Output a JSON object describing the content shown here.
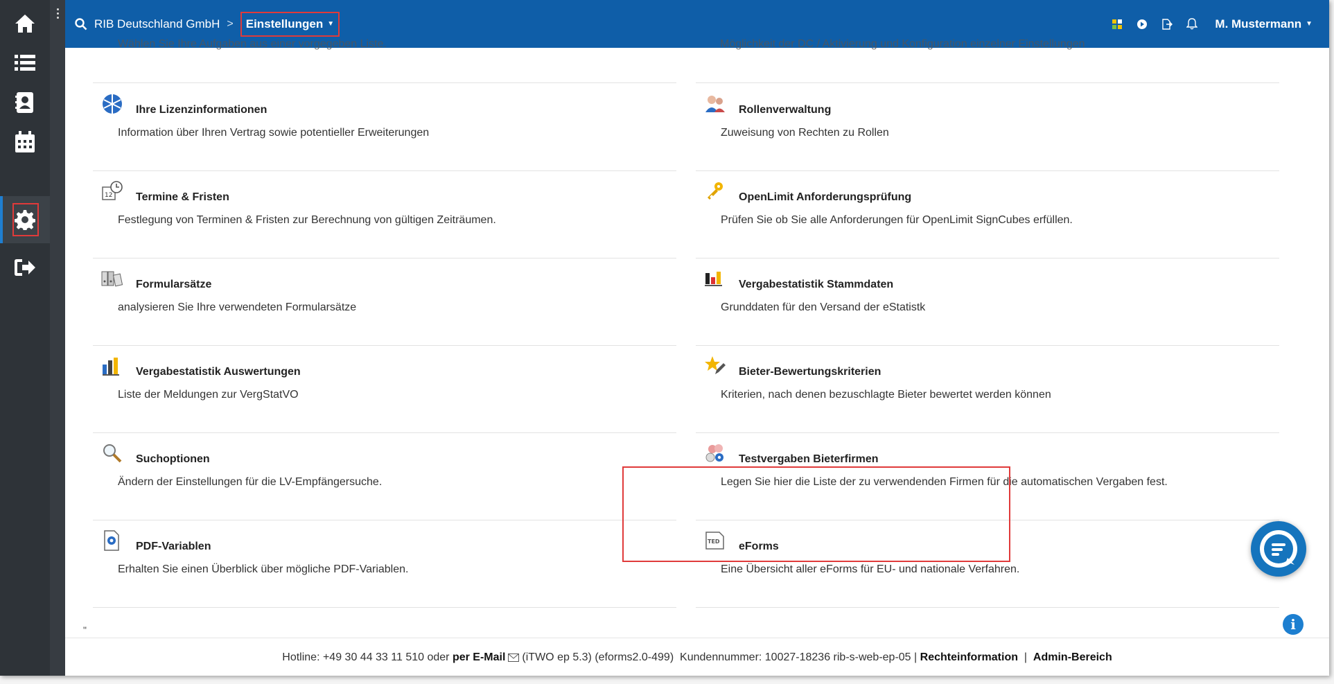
{
  "header": {
    "company": "RIB Deutschland GmbH",
    "separator": ">",
    "breadcrumb": "Einstellungen",
    "user": "M. Mustermann"
  },
  "overflow": {
    "left": "Wählen Sie Ihre Aufgaben aus einer vorgegeben Liste.",
    "right": "Möglichkeit der DC / Aktivierung und Konfiguration einzelner Einstellungen"
  },
  "settings": {
    "left": [
      {
        "title": "Ihre Lizenzinformationen",
        "desc": "Information über Ihren Vertrag sowie potentieller Erweiterungen",
        "icon": "license-icon"
      },
      {
        "title": "Termine & Fristen",
        "desc": "Festlegung von Terminen & Fristen zur Berechnung von gültigen Zeiträumen.",
        "icon": "calendar-clock-icon"
      },
      {
        "title": "Formularsätze",
        "desc": "analysieren Sie Ihre verwendeten Formularsätze",
        "icon": "binders-icon"
      },
      {
        "title": "Vergabestatistik Auswertungen",
        "desc": "Liste der Meldungen zur VergStatVO",
        "icon": "statistics-icon"
      },
      {
        "title": "Suchoptionen",
        "desc": "Ändern der Einstellungen für die LV-Empfängersuche.",
        "icon": "magnifier-icon"
      },
      {
        "title": "PDF-Variablen",
        "desc": "Erhalten Sie einen Überblick über mögliche PDF-Variablen.",
        "icon": "document-gear-icon"
      }
    ],
    "right": [
      {
        "title": "Rollenverwaltung",
        "desc": "Zuweisung von Rechten zu Rollen",
        "icon": "users-roles-icon"
      },
      {
        "title": "OpenLimit Anforderungsprüfung",
        "desc": "Prüfen Sie ob Sie alle Anforderungen für OpenLimit SignCubes erfüllen.",
        "icon": "key-icon"
      },
      {
        "title": "Vergabestatistik Stammdaten",
        "desc": "Grunddaten für den Versand der eStatistk",
        "icon": "bar-chart-icon"
      },
      {
        "title": "Bieter-Bewertungskriterien",
        "desc": "Kriterien, nach denen bezuschlagte Bieter bewertet werden können",
        "icon": "star-pencil-icon"
      },
      {
        "title": "Testvergaben Bieterfirmen",
        "desc": "Legen Sie hier die Liste der zu verwendenden Firmen für die automatischen Vergaben fest.",
        "icon": "company-settings-icon"
      },
      {
        "title": "eForms",
        "desc": "Eine Übersicht aller eForms für EU- und nationale Verfahren.",
        "icon": "ted-icon",
        "ted_label": "TED"
      }
    ]
  },
  "quote_mark": "\"",
  "footer": {
    "hotline": "Hotline: +49 30 44 33 11 510 oder",
    "email_label": "per E-Mail",
    "version": "(iTWO ep 5.3) (eforms2.0-499)",
    "customer": "Kundennummer: 10027-18236 rib-s-web-ep-05 |",
    "legal": "Rechteinformation",
    "pipe": "|",
    "admin": "Admin-Bereich"
  },
  "colors": {
    "header": "#0f5ea8",
    "sidebar": "#2e3338",
    "highlight": "#e03a3a",
    "accent": "#1574bd"
  }
}
